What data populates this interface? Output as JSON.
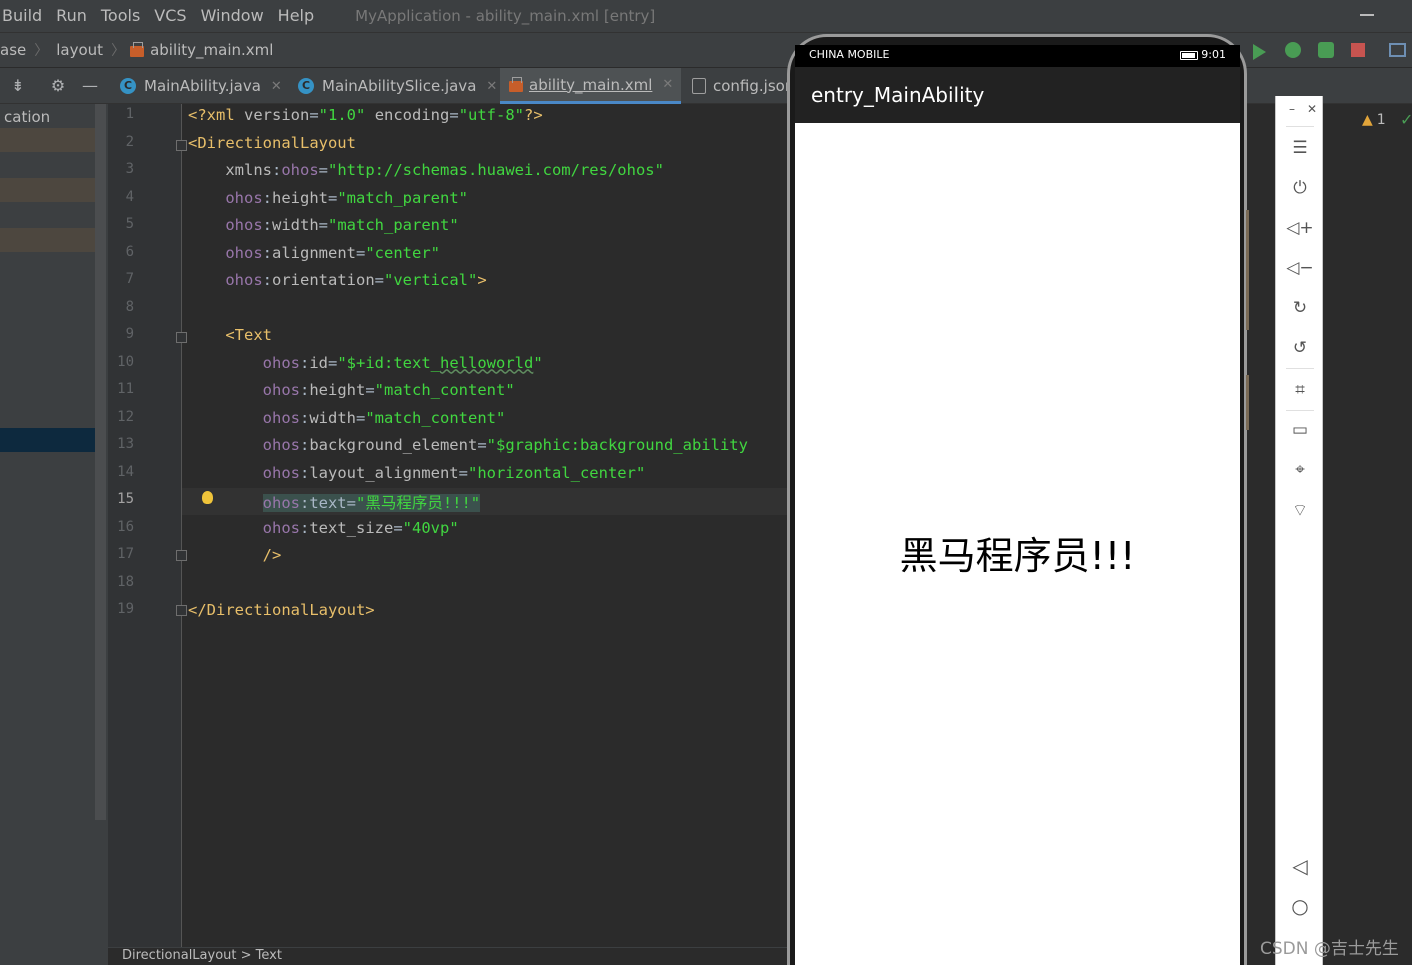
{
  "menubar": {
    "items": [
      "Build",
      "Run",
      "Tools",
      "VCS",
      "Window",
      "Help"
    ],
    "window_title": "MyApplication - ability_main.xml [entry]"
  },
  "breadcrumb": {
    "items": [
      "ase",
      "layout",
      "ability_main.xml"
    ]
  },
  "tabs": [
    {
      "label": "MainAbility.java",
      "icon": "java-class-icon"
    },
    {
      "label": "MainAbilitySlice.java",
      "icon": "java-class-icon"
    },
    {
      "label": "ability_main.xml",
      "icon": "xml-file-icon",
      "active": true
    },
    {
      "label": "config.json",
      "icon": "json-file-icon"
    }
  ],
  "project_panel": {
    "label": "cation"
  },
  "editor": {
    "current_line": 15,
    "lines": [
      {
        "n": "1",
        "parts": [
          [
            "decl",
            "<?xml "
          ],
          [
            "attr",
            "version"
          ],
          [
            "plain",
            "="
          ],
          [
            "val",
            "\"1.0\""
          ],
          [
            "plain",
            " "
          ],
          [
            "attr",
            "encoding"
          ],
          [
            "plain",
            "="
          ],
          [
            "val",
            "\"utf-8\""
          ],
          [
            "decl",
            "?>"
          ]
        ]
      },
      {
        "n": "2",
        "parts": [
          [
            "tag",
            "<DirectionalLayout"
          ]
        ]
      },
      {
        "n": "3",
        "parts": [
          [
            "plain",
            "    "
          ],
          [
            "attr",
            "xmlns"
          ],
          [
            "plain",
            ":"
          ],
          [
            "ns",
            "ohos"
          ],
          [
            "plain",
            "="
          ],
          [
            "val",
            "\"http://schemas.huawei.com/res/ohos\""
          ]
        ]
      },
      {
        "n": "4",
        "parts": [
          [
            "plain",
            "    "
          ],
          [
            "ns",
            "ohos"
          ],
          [
            "plain",
            ":"
          ],
          [
            "attr",
            "height"
          ],
          [
            "plain",
            "="
          ],
          [
            "val",
            "\"match_parent\""
          ]
        ]
      },
      {
        "n": "5",
        "parts": [
          [
            "plain",
            "    "
          ],
          [
            "ns",
            "ohos"
          ],
          [
            "plain",
            ":"
          ],
          [
            "attr",
            "width"
          ],
          [
            "plain",
            "="
          ],
          [
            "val",
            "\"match_parent\""
          ]
        ]
      },
      {
        "n": "6",
        "parts": [
          [
            "plain",
            "    "
          ],
          [
            "ns",
            "ohos"
          ],
          [
            "plain",
            ":"
          ],
          [
            "attr",
            "alignment"
          ],
          [
            "plain",
            "="
          ],
          [
            "val",
            "\"center\""
          ]
        ]
      },
      {
        "n": "7",
        "parts": [
          [
            "plain",
            "    "
          ],
          [
            "ns",
            "ohos"
          ],
          [
            "plain",
            ":"
          ],
          [
            "attr",
            "orientation"
          ],
          [
            "plain",
            "="
          ],
          [
            "val",
            "\"vertical\""
          ],
          [
            "tag",
            ">"
          ]
        ]
      },
      {
        "n": "8",
        "parts": []
      },
      {
        "n": "9",
        "parts": [
          [
            "plain",
            "    "
          ],
          [
            "tag",
            "<Text"
          ]
        ]
      },
      {
        "n": "10",
        "parts": [
          [
            "plain",
            "        "
          ],
          [
            "ns",
            "ohos"
          ],
          [
            "plain",
            ":"
          ],
          [
            "attr",
            "id"
          ],
          [
            "plain",
            "="
          ],
          [
            "val",
            "\"$+id:text_"
          ],
          [
            "valu",
            "helloworld"
          ],
          [
            "val",
            "\""
          ]
        ]
      },
      {
        "n": "11",
        "parts": [
          [
            "plain",
            "        "
          ],
          [
            "ns",
            "ohos"
          ],
          [
            "plain",
            ":"
          ],
          [
            "attr",
            "height"
          ],
          [
            "plain",
            "="
          ],
          [
            "val",
            "\"match_content\""
          ]
        ]
      },
      {
        "n": "12",
        "parts": [
          [
            "plain",
            "        "
          ],
          [
            "ns",
            "ohos"
          ],
          [
            "plain",
            ":"
          ],
          [
            "attr",
            "width"
          ],
          [
            "plain",
            "="
          ],
          [
            "val",
            "\"match_content\""
          ]
        ]
      },
      {
        "n": "13",
        "parts": [
          [
            "plain",
            "        "
          ],
          [
            "ns",
            "ohos"
          ],
          [
            "plain",
            ":"
          ],
          [
            "attr",
            "background_element"
          ],
          [
            "plain",
            "="
          ],
          [
            "val",
            "\"$graphic:background_ability"
          ]
        ]
      },
      {
        "n": "14",
        "parts": [
          [
            "plain",
            "        "
          ],
          [
            "ns",
            "ohos"
          ],
          [
            "plain",
            ":"
          ],
          [
            "attr",
            "layout_alignment"
          ],
          [
            "plain",
            "="
          ],
          [
            "val",
            "\"horizontal_center\""
          ]
        ]
      },
      {
        "n": "15",
        "parts": [
          [
            "plain",
            "        "
          ],
          [
            "nssel",
            "ohos"
          ],
          [
            "sel",
            ":text="
          ],
          [
            "valsel",
            "\"黑马程序员!!!\""
          ]
        ]
      },
      {
        "n": "16",
        "parts": [
          [
            "plain",
            "        "
          ],
          [
            "ns",
            "ohos"
          ],
          [
            "plain",
            ":"
          ],
          [
            "attr",
            "text_size"
          ],
          [
            "plain",
            "="
          ],
          [
            "val",
            "\"40vp\""
          ]
        ]
      },
      {
        "n": "17",
        "parts": [
          [
            "plain",
            "        "
          ],
          [
            "tag",
            "/>"
          ]
        ]
      },
      {
        "n": "18",
        "parts": []
      },
      {
        "n": "19",
        "parts": [
          [
            "tag",
            "</DirectionalLayout>"
          ]
        ]
      }
    ],
    "status_path": "DirectionalLayout > Text"
  },
  "phone": {
    "carrier": "CHINA MOBILE",
    "time": "9:01",
    "app_title": "entry_MainAbility",
    "display_text": "黑马程序员!!!"
  },
  "inspections": {
    "warning_count": "1"
  },
  "watermark": "CSDN @吉士先生"
}
